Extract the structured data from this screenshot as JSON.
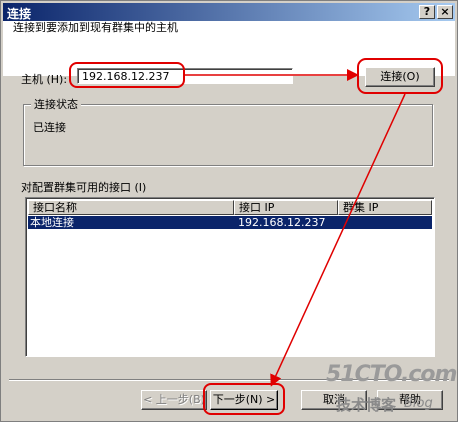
{
  "window": {
    "title": "连接",
    "help_glyph": "?",
    "close_glyph": "×"
  },
  "header": {
    "instruction": "连接到要添加到现有群集中的主机"
  },
  "host": {
    "label": "主机 (H):",
    "value": "192.168.12.237",
    "connect_button": "连接(O)"
  },
  "status": {
    "legend": "连接状态",
    "value": "已连接"
  },
  "interfaces": {
    "label": "对配置群集可用的接口 (I)",
    "columns": [
      "接口名称",
      "接口 IP",
      "群集 IP"
    ],
    "rows": [
      {
        "name": "本地连接",
        "ip": "192.168.12.237",
        "cluster_ip": ""
      }
    ]
  },
  "footer": {
    "back_button": "< 上一步(B)",
    "next_button": "下一步(N) >",
    "cancel_button": "取消",
    "help_button": "帮助"
  },
  "watermark": {
    "main": "51CTO.com",
    "sub1": "技术博客",
    "sub2": "Blog"
  },
  "colors": {
    "annotation": "#e00000",
    "selection": "#0a246a",
    "dialog_face": "#d4d0c8"
  }
}
